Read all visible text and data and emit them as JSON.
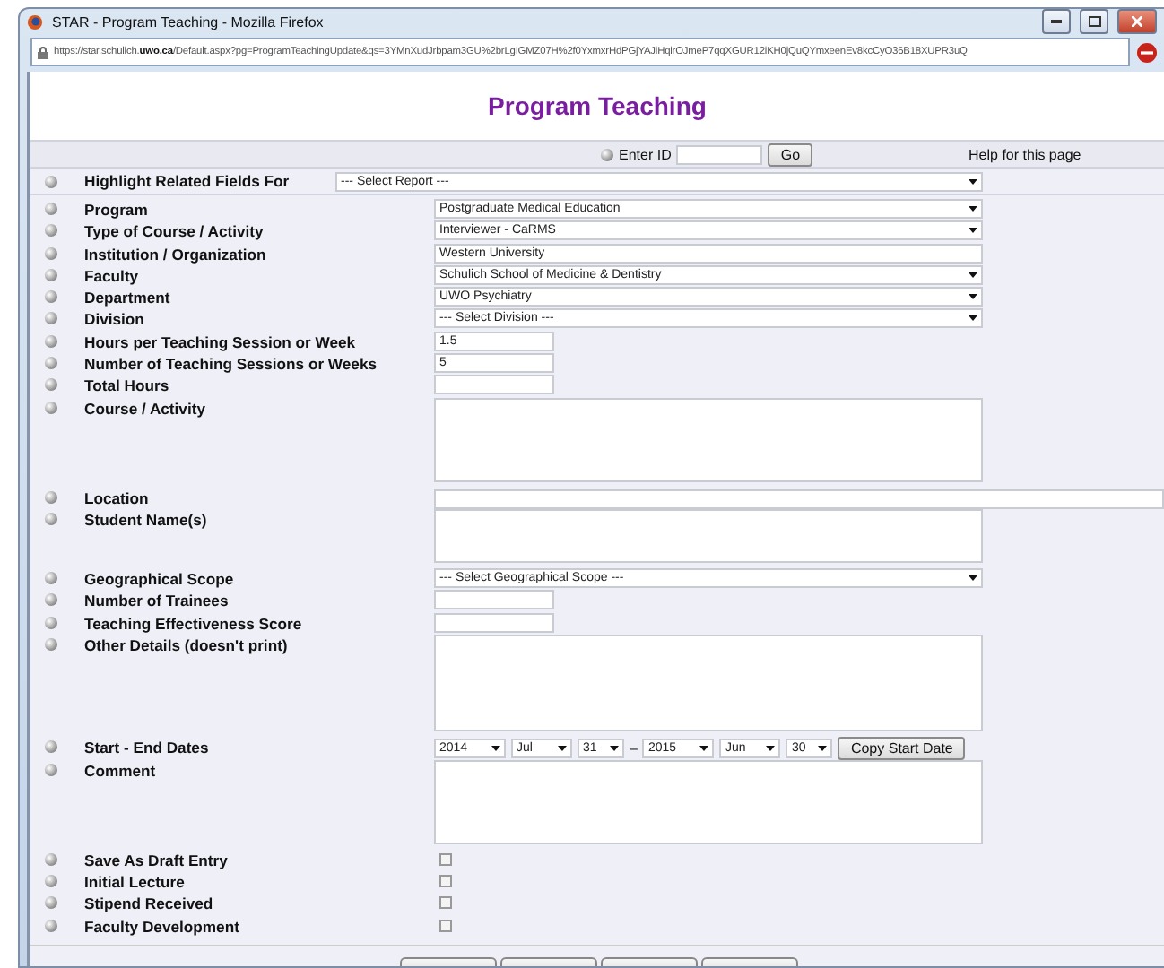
{
  "window": {
    "title": "STAR - Program Teaching - Mozilla Firefox"
  },
  "address_bar": {
    "url": "https://star.schulich.**uwo.ca**/Default.aspx?pg=ProgramTeachingUpdate&qs=3YMnXudJrbpam3GU%2brLgIGMZ07H%2f0YxmxrHdPGjYAJiHqirOJmeP7qqXGUR12iKH0jQuQYmxeenEv8kcCyO36B18XUPR3uQ"
  },
  "page": {
    "title": "Program Teaching",
    "enter_id": {
      "label": "Enter ID",
      "button": "Go"
    },
    "help_link": "Help for this page"
  },
  "highlight": {
    "label": "Highlight Related Fields For",
    "value": "--- Select Report ---"
  },
  "fields": [
    {
      "kind": "select",
      "label": "Program",
      "value": "Postgraduate Medical Education"
    },
    {
      "kind": "select",
      "label": "Type of Course / Activity",
      "value": "Interviewer - CaRMS"
    },
    {
      "kind": "wide-text",
      "label": "Institution / Organization",
      "value": "Western University"
    },
    {
      "kind": "select",
      "label": "Faculty",
      "value": "Schulich School of Medicine & Dentistry"
    },
    {
      "kind": "select",
      "label": "Department",
      "value": "UWO Psychiatry"
    },
    {
      "kind": "select",
      "label": "Division",
      "value": "--- Select Division ---"
    },
    {
      "kind": "short-text",
      "label": "Hours per Teaching Session or Week",
      "value": "1.5"
    },
    {
      "kind": "short-text",
      "label": "Number of Teaching Sessions or Weeks",
      "value": "5"
    },
    {
      "kind": "short-text",
      "label": "Total Hours"
    },
    {
      "kind": "textarea",
      "label": "Course / Activity"
    },
    {
      "kind": "full-text",
      "label": "Location"
    },
    {
      "kind": "small-textarea",
      "label": "Student Name(s)"
    },
    {
      "kind": "select",
      "label": "Geographical Scope",
      "value": "--- Select Geographical Scope ---"
    },
    {
      "kind": "short-text",
      "label": "Number of Trainees"
    },
    {
      "kind": "short-text",
      "label": "Teaching Effectiveness Score"
    },
    {
      "kind": "textarea",
      "label": "Other Details (doesn't print)"
    },
    {
      "kind": "dates",
      "label": "Start - End Dates",
      "start": [
        "2014",
        "Jul",
        "31"
      ],
      "separator": "–",
      "end": [
        "2015",
        "Jun",
        "30"
      ],
      "button": "Copy Start Date"
    },
    {
      "kind": "textarea",
      "label": "Comment"
    },
    {
      "kind": "checkbox",
      "label": "Save As Draft Entry",
      "checked": false
    },
    {
      "kind": "checkbox",
      "label": "Initial Lecture",
      "checked": false
    },
    {
      "kind": "checkbox",
      "label": "Stipend Received",
      "checked": false
    },
    {
      "kind": "checkbox",
      "label": "Faculty Development",
      "checked": false
    }
  ]
}
